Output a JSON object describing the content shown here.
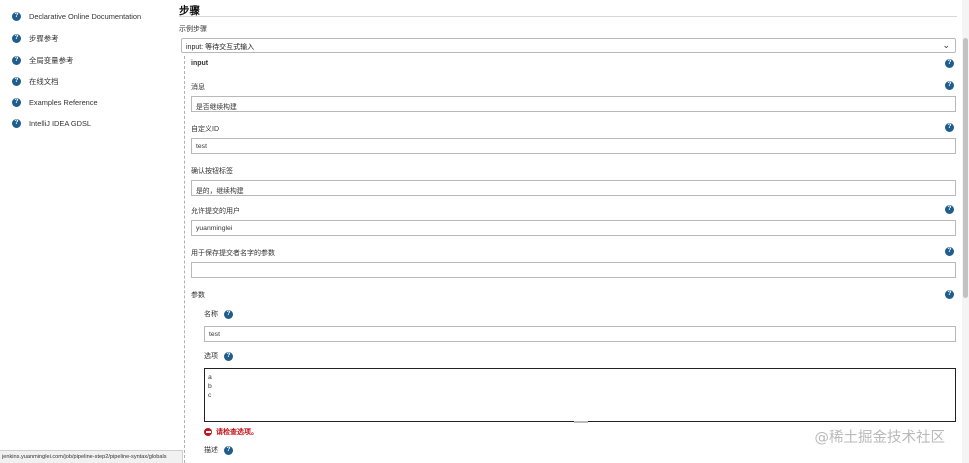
{
  "sidebar": {
    "items": [
      {
        "label": "Declarative Online Documentation"
      },
      {
        "label": "步骤参考"
      },
      {
        "label": "全局变量参考"
      },
      {
        "label": "在线文档"
      },
      {
        "label": "Examples Reference"
      },
      {
        "label": "IntelliJ IDEA GDSL"
      }
    ]
  },
  "main": {
    "title": "步骤",
    "sample_step_label": "示例步骤",
    "sample_step_value": "input: 等待交互式输入",
    "step_name": "input",
    "fields": {
      "message_label": "消息",
      "message_value": "是否继续构建",
      "custom_id_label": "自定义ID",
      "custom_id_value": "test",
      "ok_label": "确认按钮标签",
      "ok_value": "是的，继续构建",
      "submitter_label": "允许提交的用户",
      "submitter_value": "yuanminglei",
      "submitter_param_label": "用于保存提交者名字的参数",
      "submitter_param_value": "",
      "params_label": "参数",
      "param_name_label": "名称",
      "param_name_value": "test",
      "choices_label": "选项",
      "choices_value": "a\nb\nc",
      "choices_error": "请检查选项。",
      "description_label": "描述"
    }
  },
  "statusbar": {
    "url": "jenkins.yuanminglei.com/job/pipeline-step2/pipeline-syntax/globals"
  },
  "watermark": "@稀土掘金技术社区",
  "icons": {
    "help": "?"
  },
  "colors": {
    "help_icon": "#1f5d8c",
    "error": "#c4151c"
  }
}
